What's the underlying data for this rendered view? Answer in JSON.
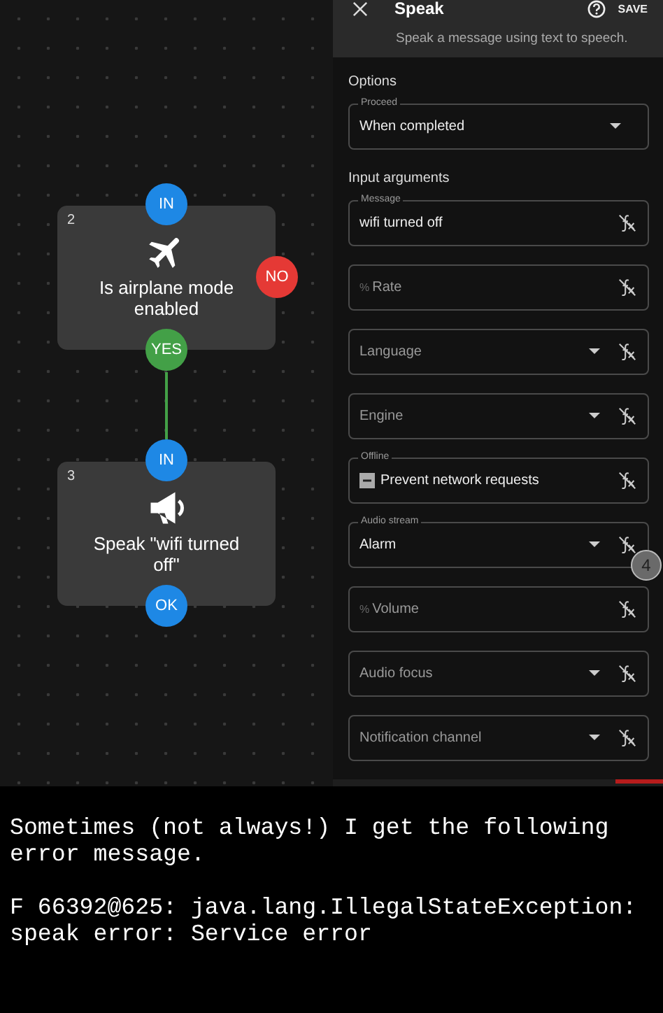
{
  "canvas": {
    "nodes": [
      {
        "number": "2",
        "kind": "condition",
        "title": "Is airplane mode enabled",
        "ports": [
          {
            "label": "IN",
            "kind": "input"
          },
          {
            "label": "NO",
            "kind": "no"
          },
          {
            "label": "YES",
            "kind": "yes",
            "connected": true
          }
        ]
      },
      {
        "number": "3",
        "kind": "speak",
        "title": "Speak \"wifi turned off\"",
        "ports": [
          {
            "label": "IN",
            "kind": "input"
          },
          {
            "label": "OK",
            "kind": "output"
          }
        ]
      }
    ]
  },
  "panel": {
    "title": "Speak",
    "subtitle": "Speak a message using text to speech.",
    "action": "SAVE",
    "sections": [
      {
        "heading": "Options",
        "fields": [
          {
            "kind": "select",
            "label": "Proceed",
            "value": "When completed",
            "formula": false
          }
        ]
      },
      {
        "heading": "Input arguments",
        "fields": [
          {
            "kind": "text",
            "label": "Message",
            "value": "wifi turned off",
            "formula": true
          },
          {
            "kind": "text",
            "prefix": "%",
            "placeholder": "Rate",
            "formula": true
          },
          {
            "kind": "select",
            "placeholder": "Language",
            "formula": true
          },
          {
            "kind": "select",
            "placeholder": "Engine",
            "formula": true
          },
          {
            "kind": "checkbox",
            "label": "Offline",
            "text": "Prevent network requests",
            "indeterminate": true,
            "formula": true
          },
          {
            "kind": "select",
            "label": "Audio stream",
            "value": "Alarm",
            "formula": true,
            "badge": "4"
          },
          {
            "kind": "text",
            "prefix": "%",
            "placeholder": "Volume",
            "formula": true
          },
          {
            "kind": "select",
            "placeholder": "Audio focus",
            "formula": true
          },
          {
            "kind": "select",
            "placeholder": "Notification channel",
            "formula": true
          }
        ]
      }
    ]
  },
  "post": {
    "paragraphs": [
      "Sometimes (not always!) I get the following error message.",
      "F 66392@625: java.lang.IllegalStateException: speak error: Service error"
    ]
  }
}
